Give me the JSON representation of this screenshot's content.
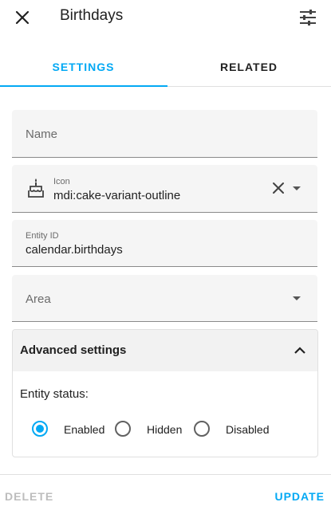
{
  "header": {
    "title": "Birthdays",
    "close_icon": "close-icon",
    "settings_icon": "tune-icon"
  },
  "tabs": [
    {
      "label": "SETTINGS",
      "active": true
    },
    {
      "label": "RELATED",
      "active": false
    }
  ],
  "form": {
    "name": {
      "placeholder": "Name",
      "value": ""
    },
    "icon": {
      "label": "Icon",
      "value": "mdi:cake-variant-outline",
      "icon": "cake-variant-outline-icon"
    },
    "entity_id": {
      "label": "Entity ID",
      "value": "calendar.birthdays"
    },
    "area": {
      "placeholder": "Area",
      "value": ""
    }
  },
  "advanced": {
    "title": "Advanced settings",
    "expanded": true,
    "status_label": "Entity status:",
    "options": [
      {
        "label": "Enabled",
        "selected": true
      },
      {
        "label": "Hidden",
        "selected": false
      },
      {
        "label": "Disabled",
        "selected": false
      }
    ]
  },
  "footer": {
    "delete_label": "DELETE",
    "update_label": "UPDATE"
  },
  "colors": {
    "accent": "#03a9f4",
    "field_bg": "#f5f5f5",
    "disabled_text": "#bdbdbd"
  }
}
